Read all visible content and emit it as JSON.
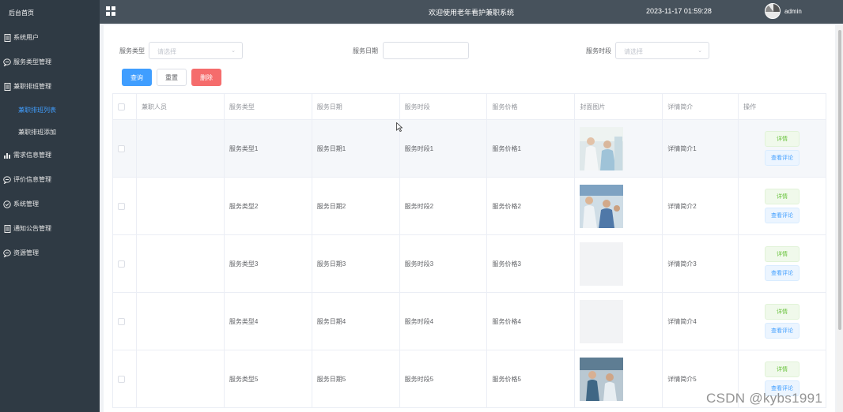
{
  "sidebar": {
    "home": "后台首页",
    "items": [
      {
        "label": "系统用户",
        "icon": "document-icon"
      },
      {
        "label": "服务类型管理",
        "icon": "chat-icon"
      },
      {
        "label": "兼职排班管理",
        "icon": "document-icon"
      },
      {
        "label": "需求信息管理",
        "icon": "bar-chart-icon"
      },
      {
        "label": "评价信息管理",
        "icon": "chat-icon"
      },
      {
        "label": "系统管理",
        "icon": "check-circle-icon"
      },
      {
        "label": "通知公告管理",
        "icon": "document-icon"
      },
      {
        "label": "资源管理",
        "icon": "chat-icon"
      }
    ],
    "sub_items": [
      {
        "label": "兼职排班列表",
        "active": true
      },
      {
        "label": "兼职排班添加",
        "active": false
      }
    ]
  },
  "header": {
    "title": "欢迎使用老年看护兼职系统",
    "datetime": "2023-11-17 01:59:28",
    "user": "admin"
  },
  "filters": {
    "service_type_label": "服务类型",
    "service_type_placeholder": "请选择",
    "service_date_label": "服务日期",
    "service_date_value": "",
    "service_period_label": "服务时段",
    "service_period_placeholder": "请选择",
    "query_button": "查询",
    "reset_button": "重置",
    "delete_button": "删除"
  },
  "table": {
    "columns": [
      "兼职人员",
      "服务类型",
      "服务日期",
      "服务时段",
      "服务价格",
      "封面图片",
      "详情简介",
      "操作"
    ],
    "rows": [
      {
        "staff": "",
        "type": "服务类型1",
        "date": "服务日期1",
        "period": "服务时段1",
        "price": "服务价格1",
        "intro": "详情简介1",
        "has_image": true
      },
      {
        "staff": "",
        "type": "服务类型2",
        "date": "服务日期2",
        "period": "服务时段2",
        "price": "服务价格2",
        "intro": "详情简介2",
        "has_image": true
      },
      {
        "staff": "",
        "type": "服务类型3",
        "date": "服务日期3",
        "period": "服务时段3",
        "price": "服务价格3",
        "intro": "详情简介3",
        "has_image": false
      },
      {
        "staff": "",
        "type": "服务类型4",
        "date": "服务日期4",
        "period": "服务时段4",
        "price": "服务价格4",
        "intro": "详情简介4",
        "has_image": false
      },
      {
        "staff": "",
        "type": "服务类型5",
        "date": "服务日期5",
        "period": "服务时段5",
        "price": "服务价格5",
        "intro": "详情简介5",
        "has_image": true
      }
    ],
    "detail_button": "详情",
    "review_button": "查看评论"
  },
  "watermark": "CSDN @kybs1991",
  "colors": {
    "sidebar_bg": "#2f3a44",
    "topbar_bg": "#47525c",
    "primary": "#409eff",
    "danger": "#f56c6c",
    "success": "#67c23a"
  }
}
